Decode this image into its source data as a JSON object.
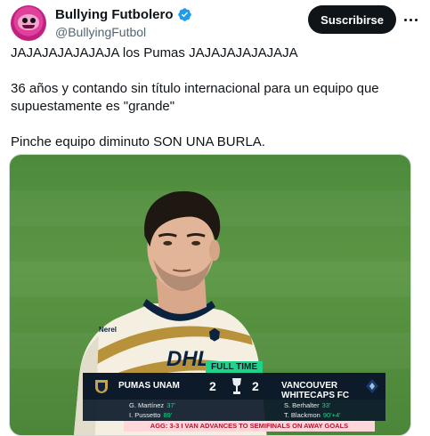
{
  "author": {
    "display_name": "Bullying Futbolero",
    "handle": "@BullyingFutbol",
    "verified": true,
    "verified_icon": "verified-badge-icon",
    "avatar_icon": "avatar-icon"
  },
  "actions": {
    "subscribe_label": "Suscribirse",
    "more_icon": "more-icon"
  },
  "tweet": {
    "paragraphs": [
      "JAJAJAJAJAJAJA los Pumas JAJAJAJAJAJAJA",
      "36 años y contando sin título internacional para un equipo que\nsupuestamente es \"grande\"",
      "Pinche equipo diminuto SON UNA BURLA."
    ]
  },
  "media": {
    "scoreboard": {
      "status": "FULL TIME",
      "home_team": "PUMAS UNAM",
      "away_team": "VANCOUVER WHITECAPS FC",
      "home_score": "2",
      "away_score": "2",
      "home_scorers": [
        {
          "name": "G. Martínez",
          "minute": "37'"
        },
        {
          "name": "I. Pussetto",
          "minute": "89'"
        }
      ],
      "away_scorers": [
        {
          "name": "S. Berhalter",
          "minute": "33'"
        },
        {
          "name": "T. Blackmon",
          "minute": "90'+4'"
        }
      ],
      "aggregate": "AGG: 3-3 I VAN ADVANCES TO SEMIFINALS ON AWAY GOALS"
    },
    "shirt_sponsor": "DHL",
    "shirt_brand": "Nerel",
    "colors": {
      "pitch": "#4e8a3c",
      "shirt": "#f4efe0",
      "shirt_accent": "#b8923a",
      "scoreboard_bg": "#0c1a2a",
      "full_time_tag": "#1fd38a",
      "aggregate_bg": "#ffd7db"
    }
  }
}
